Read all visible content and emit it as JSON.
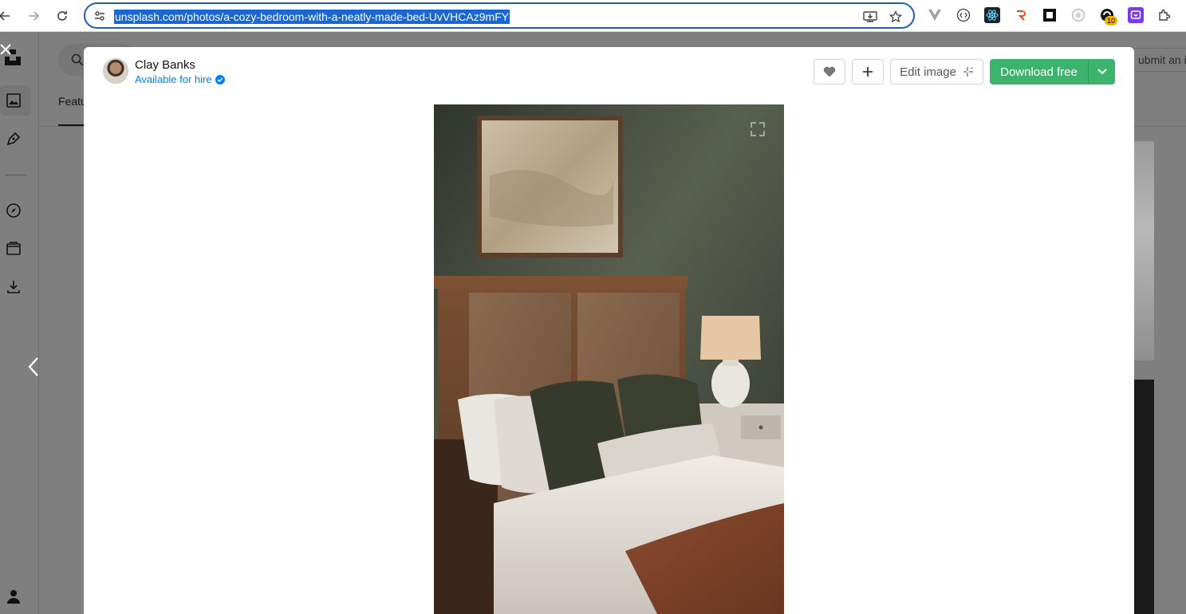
{
  "browser": {
    "url": "unsplash.com/photos/a-cozy-bedroom-with-a-neatly-made-bed-UvVHCAz9mFY",
    "extension_badge": "10"
  },
  "background_page": {
    "featured_tab": "Featu",
    "submit_button": "ubmit an i"
  },
  "modal": {
    "author": {
      "name": "Clay Banks",
      "status": "Available for hire"
    },
    "actions": {
      "edit_label": "Edit image",
      "download_label": "Download free"
    },
    "photo": {
      "alt": "a cozy bedroom with a neatly made bed"
    }
  },
  "colors": {
    "download_green": "#3cb46e",
    "hire_blue": "#007fff",
    "url_highlight": "#1a67d2"
  }
}
